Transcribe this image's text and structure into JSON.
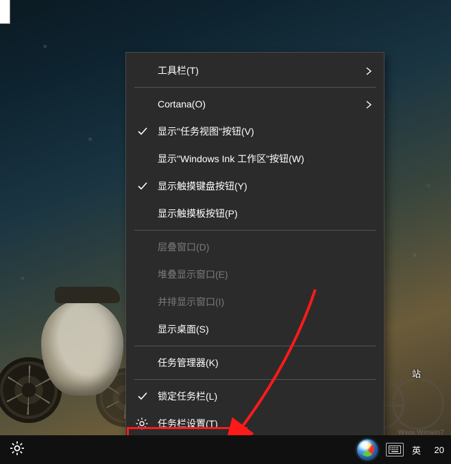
{
  "menu": {
    "toolbars": "工具栏(T)",
    "cortana": "Cortana(O)",
    "show_taskview": "显示\"任务视图\"按钮(V)",
    "show_ink": "显示\"Windows Ink 工作区\"按钮(W)",
    "show_touch_keyboard": "显示触摸键盘按钮(Y)",
    "show_touchpad": "显示触摸板按钮(P)",
    "cascade": "层叠窗口(D)",
    "stacked": "堆叠显示窗口(E)",
    "sidebyside": "并排显示窗口(I)",
    "show_desktop": "显示桌面(S)",
    "task_manager": "任务管理器(K)",
    "lock_taskbar": "锁定任务栏(L)",
    "taskbar_settings": "任务栏设置(T)"
  },
  "tray": {
    "lang": "英",
    "clock": "20",
    "win7_label": "Win",
    "watermark": "Www.Winwin7"
  },
  "desktop": {
    "icon_label": "站"
  }
}
